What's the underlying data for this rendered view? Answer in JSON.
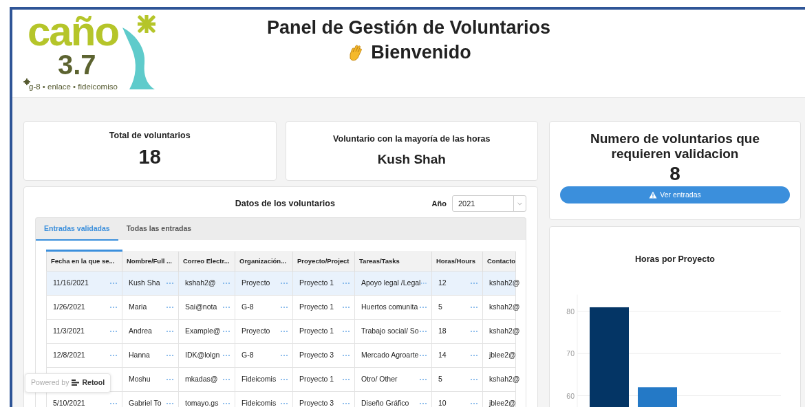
{
  "header": {
    "logo": {
      "word": "caño",
      "number": "3.7",
      "tagline": "g-8 • enlace • fideicomiso"
    },
    "title": "Panel de Gestión de Voluntarios",
    "subtitle": "Bienvenido"
  },
  "stats": [
    {
      "label": "Total de voluntarios",
      "value": "18",
      "kind": "number"
    },
    {
      "label": "Voluntario con la mayoría de las horas",
      "value": "Kush Shah",
      "kind": "name"
    }
  ],
  "data_panel": {
    "title": "Datos de los voluntarios",
    "year_filter": {
      "label": "Año",
      "value": "2021"
    },
    "tabs": [
      {
        "label": "Entradas validadas",
        "selected": true
      },
      {
        "label": "Todas las entradas",
        "selected": false
      }
    ],
    "table": {
      "columns": [
        "Fecha en la que se...",
        "Nombre/Full ...",
        "Correo Electr...",
        "Organización...",
        "Proyecto/Project",
        "Tareas/Tasks",
        "Horas/Hours",
        "Contacto"
      ],
      "rows": [
        {
          "selected": true,
          "cells": [
            "11/16/2021",
            "Kush Sha",
            "kshah2@",
            "Proyecto",
            "Proyecto 1",
            "Apoyo legal /Legal",
            "12",
            "kshah2@"
          ]
        },
        {
          "selected": false,
          "cells": [
            "1/26/2021",
            "Maria",
            "Sai@nota",
            "G-8",
            "Proyecto 1",
            "Huertos comunita",
            "5",
            "kshah2@"
          ]
        },
        {
          "selected": false,
          "cells": [
            "11/3/2021",
            "Andrea",
            "Example@",
            "Proyecto",
            "Proyecto 1",
            "Trabajo social/ So",
            "18",
            "kshah2@"
          ]
        },
        {
          "selected": false,
          "cells": [
            "12/8/2021",
            "Hanna",
            "IDK@lolgn",
            "G-8",
            "Proyecto 3",
            "Mercado Agroarte",
            "14",
            "jblee2@"
          ]
        },
        {
          "selected": false,
          "cells": [
            null,
            "Moshu",
            "mkadas@",
            "Fideicomis",
            "Proyecto 1",
            "Otro/ Other",
            "5",
            "kshah2@"
          ]
        },
        {
          "selected": false,
          "cells": [
            "5/10/2021",
            "Gabriel To",
            "tomayo.gs",
            "Fideicomis",
            "Proyecto 3",
            "Diseño Gráfico",
            "10",
            "jblee2@"
          ]
        }
      ]
    }
  },
  "validation_card": {
    "title": "Numero de voluntarios que requieren validacion",
    "value": "8",
    "button": "Ver entradas"
  },
  "chart": {
    "chart_data": {
      "type": "bar",
      "title": "Horas por Proyecto",
      "ylim": [
        56,
        84
      ],
      "yticks": [
        60,
        70,
        80
      ],
      "grid": true,
      "stacked": true,
      "series": [
        {
          "color": "#043565",
          "values": [
            81,
            null
          ]
        },
        {
          "color": "#2479c6",
          "values": [
            null,
            62
          ]
        }
      ]
    }
  },
  "badge": {
    "prefix": "Powered by",
    "brand": "Retool"
  }
}
